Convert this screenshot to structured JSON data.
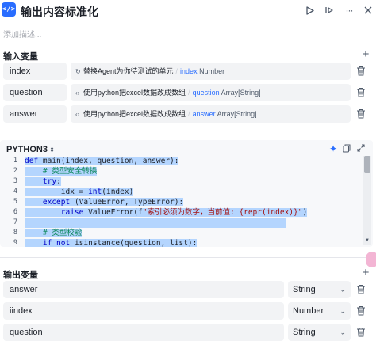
{
  "header": {
    "app_icon": "</>",
    "title": "输出内容标准化",
    "run_icon": "play-icon",
    "debug_icon": "debug-icon",
    "more_icon": "more-icon"
  },
  "description_placeholder": "添加描述...",
  "inputs": {
    "label": "输入变量",
    "rows": [
      {
        "name": "index",
        "ref_icon": "↻",
        "ref": "替换Agent为你待测试的单元",
        "var": "index",
        "type": "Number"
      },
      {
        "name": "question",
        "ref_icon": "‹›",
        "ref": "使用python把excel数据改成数组",
        "var": "question",
        "type": "Array[String]"
      },
      {
        "name": "answer",
        "ref_icon": "‹›",
        "ref": "使用python把excel数据改成数组",
        "var": "answer",
        "type": "Array[String]"
      }
    ]
  },
  "editor": {
    "language": "PYTHON3",
    "lines": [
      {
        "n": "1",
        "text": "def main(index, question, answer):"
      },
      {
        "n": "2",
        "text": "    # 类型安全转换"
      },
      {
        "n": "3",
        "text": "    try:"
      },
      {
        "n": "4",
        "text": "        idx = int(index)"
      },
      {
        "n": "5",
        "text": "    except (ValueError, TypeError):"
      },
      {
        "n": "6",
        "text": "        raise ValueError(f\"索引必须为数字，当前值: {repr(index)}\")"
      },
      {
        "n": "7",
        "text": ""
      },
      {
        "n": "8",
        "text": "    # 类型校验"
      },
      {
        "n": "9",
        "text": "    if not isinstance(question, list):"
      }
    ]
  },
  "outputs": {
    "label": "输出变量",
    "rows": [
      {
        "name": "answer",
        "type": "String"
      },
      {
        "name": "iindex",
        "type": "Number"
      },
      {
        "name": "question",
        "type": "String"
      }
    ]
  },
  "colors": {
    "accent": "#296dff",
    "selection": "#b4d5fe",
    "field_bg": "#f2f3f5"
  }
}
